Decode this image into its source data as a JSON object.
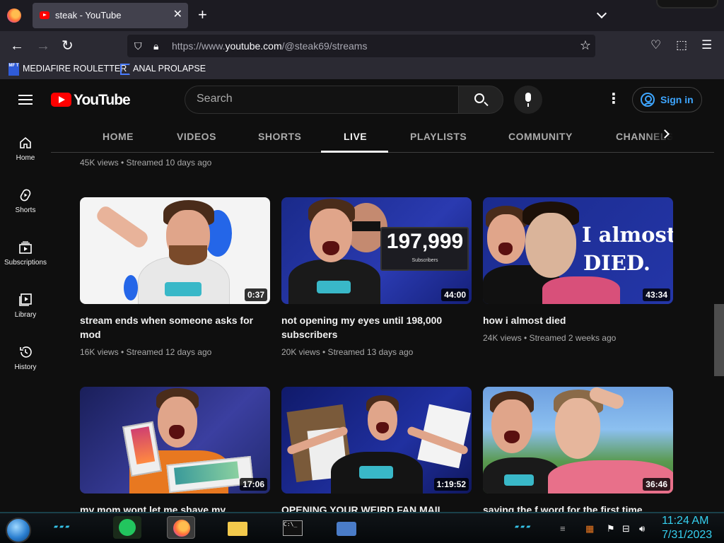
{
  "browser": {
    "tab_title": "steak - YouTube",
    "tab_close": "✕",
    "new_tab": "+",
    "url_prefix": "https://www.",
    "url_domain": "youtube.com",
    "url_path": "/@steak69/streams",
    "bookmarks": [
      {
        "label": "MEDIAFIRE ROULETTER",
        "icon_text": "MF T"
      },
      {
        "label": "ANAL PROLAPSE"
      }
    ]
  },
  "youtube": {
    "logo_text": "YouTube",
    "search_placeholder": "Search",
    "sign_in": "Sign in",
    "guide": [
      {
        "label": "Home",
        "icon": "home-icon"
      },
      {
        "label": "Shorts",
        "icon": "shorts-icon"
      },
      {
        "label": "Subscriptions",
        "icon": "subscriptions-icon"
      },
      {
        "label": "Library",
        "icon": "library-icon"
      },
      {
        "label": "History",
        "icon": "history-icon"
      }
    ],
    "tabs": [
      "HOME",
      "VIDEOS",
      "SHORTS",
      "LIVE",
      "PLAYLISTS",
      "COMMUNITY",
      "CHANNELS"
    ],
    "active_tab": "LIVE",
    "prev_meta": "45K views • Streamed 10 days ago",
    "videos": [
      {
        "title": "stream ends when someone asks for mod",
        "meta": "16K views • Streamed 12 days ago",
        "duration": "0:37"
      },
      {
        "title": "not opening my eyes until 198,000 subscribers",
        "meta": "20K views • Streamed 13 days ago",
        "duration": "44:00",
        "overlay_number": "197,999",
        "overlay_caption": "Subscribers"
      },
      {
        "title": "how i almost died",
        "meta": "24K views • Streamed 2 weeks ago",
        "duration": "43:34",
        "overlay_line1": "I almost",
        "overlay_line2": "DIED."
      },
      {
        "title": "my mom wont let me shave my",
        "meta": "",
        "duration": "17:06"
      },
      {
        "title": "OPENING YOUR WEIRD FAN MAIL",
        "meta": "",
        "duration": "1:19:52"
      },
      {
        "title": "saying the f word for the first time",
        "meta": "",
        "duration": "36:46"
      }
    ]
  },
  "taskbar": {
    "time": "11:24 AM",
    "date": "7/31/2023"
  }
}
